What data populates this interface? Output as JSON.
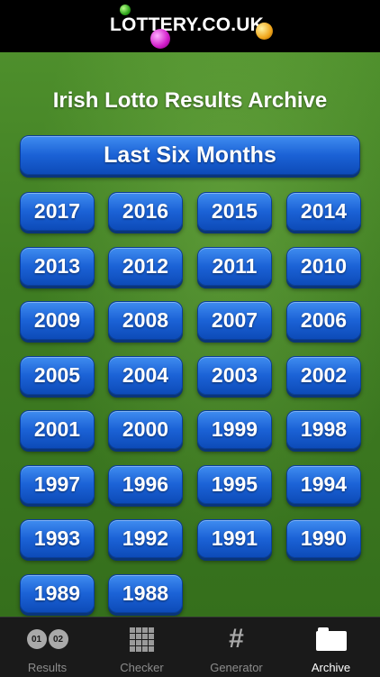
{
  "header": {
    "logo_text": "LOTTERY.CO.UK"
  },
  "main": {
    "title": "Irish Lotto Results Archive",
    "last_six_months_label": "Last Six Months",
    "years": [
      "2017",
      "2016",
      "2015",
      "2014",
      "2013",
      "2012",
      "2011",
      "2010",
      "2009",
      "2008",
      "2007",
      "2006",
      "2005",
      "2004",
      "2003",
      "2002",
      "2001",
      "2000",
      "1999",
      "1998",
      "1997",
      "1996",
      "1995",
      "1994",
      "1993",
      "1992",
      "1991",
      "1990",
      "1989",
      "1988"
    ]
  },
  "tabbar": {
    "tabs": [
      {
        "label": "Results",
        "icon": "numbered-balls-icon",
        "pill_a": "01",
        "pill_b": "02"
      },
      {
        "label": "Checker",
        "icon": "grid-icon"
      },
      {
        "label": "Generator",
        "icon": "hash-icon",
        "glyph": "#"
      },
      {
        "label": "Archive",
        "icon": "folder-icon",
        "active": true
      }
    ]
  },
  "colors": {
    "button_blue": "#1b62d6",
    "background_green": "#3f7d22",
    "tabbar": "#1a1a1a"
  }
}
